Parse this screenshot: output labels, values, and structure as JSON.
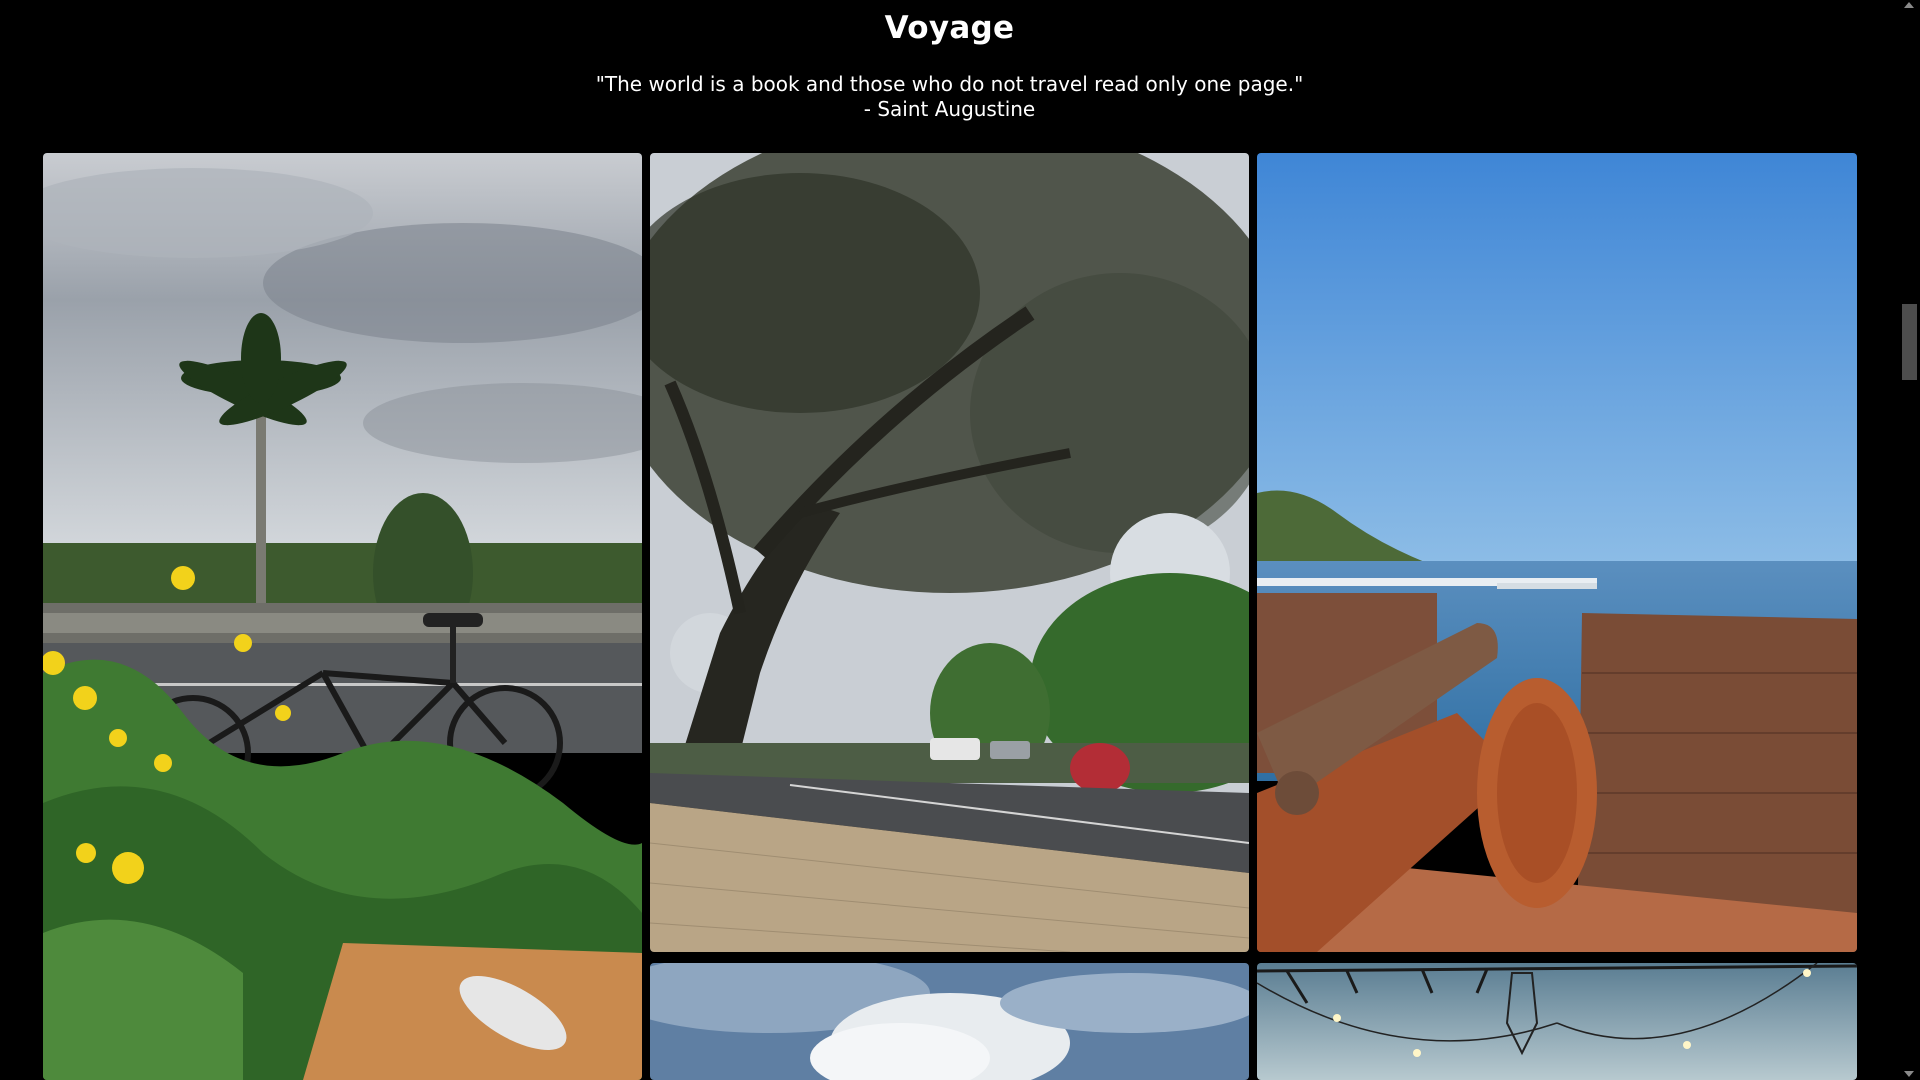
{
  "page": {
    "title": "Voyage",
    "quote_text": "\"The world is a book and those who do not travel read only one page.\"",
    "quote_author": "- Saint Augustine"
  },
  "gallery": {
    "photos": [
      {
        "subject": "bicycle by palm tree and yellow flowers"
      },
      {
        "subject": "large tree over street with traffic"
      },
      {
        "subject": "cannon on fort wall overlooking sea"
      },
      {
        "subject": "clouds in blue sky"
      },
      {
        "subject": "string lights at dusk"
      }
    ]
  },
  "colors": {
    "background": "#000000",
    "text": "#ffffff",
    "scroll_thumb": "#4d4d4d"
  }
}
